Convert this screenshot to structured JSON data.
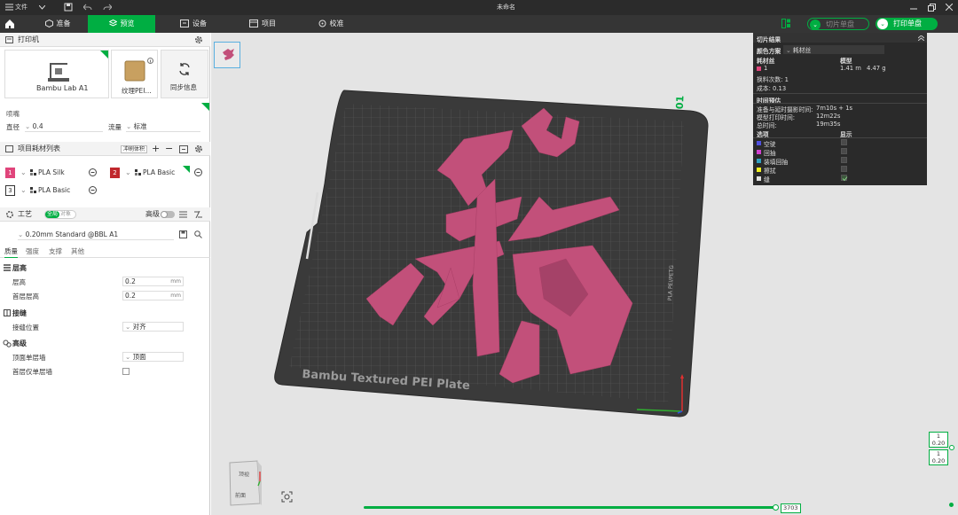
{
  "titlebar": {
    "file_menu": "文件",
    "title": "未命名"
  },
  "tabs": [
    {
      "label": "准备"
    },
    {
      "label": "预览"
    },
    {
      "label": "设备"
    },
    {
      "label": "项目"
    },
    {
      "label": "校准"
    }
  ],
  "toolbar": {
    "slice_label": "切片单盘",
    "print_label": "打印单盘"
  },
  "printer": {
    "section_title": "打印机",
    "printer_name": "Bambu Lab A1",
    "plate_name": "纹理PEI...",
    "sync_label": "同步信息",
    "nozzle_label": "喷嘴",
    "diameter_label": "直径",
    "diameter_value": "0.4",
    "flow_label": "流量",
    "flow_value": "标准"
  },
  "filaments": {
    "section_title": "项目耗材列表",
    "flush_label": "冲刷体积",
    "items": [
      {
        "num": "1",
        "name": "PLA Silk",
        "color": "#e0457b"
      },
      {
        "num": "2",
        "name": "PLA Basic",
        "color": "#c0282d"
      },
      {
        "num": "3",
        "name": "PLA Basic",
        "color": "#ffffff"
      }
    ]
  },
  "process": {
    "section_title": "工艺",
    "global_label": "全局",
    "object_label": "对象",
    "advanced_label": "高级",
    "preset": "0.20mm Standard @BBL A1",
    "subtabs": [
      "质量",
      "强度",
      "支撑",
      "其他"
    ],
    "groups": {
      "layer_height": "层高",
      "seam": "接缝",
      "advanced": "高级"
    },
    "rows": {
      "layer_height_label": "层高",
      "layer_height_value": "0.2",
      "first_layer_label": "首层层高",
      "first_layer_value": "0.2",
      "unit": "mm",
      "seam_pos_label": "接缝位置",
      "seam_pos_value": "对齐",
      "top_surface_label": "顶面单层墙",
      "top_surface_value": "顶面",
      "first_layer_wall_label": "首层仅单层墙"
    }
  },
  "stats": {
    "title": "切片结果",
    "scheme_label": "颜色方案",
    "scheme_value": "耗材丝",
    "col_filament": "耗材丝",
    "col_model": "模型",
    "row1_num": "1",
    "row1_length": "1.41 m",
    "row1_weight": "4.47 g",
    "changes": "换料次数: 1",
    "cost": "成本: 0.13",
    "time_title": "时间预估",
    "prep_label": "准备与延时摄影时间:",
    "prep_value": "7m10s + 1s",
    "model_time_label": "模型打印时间:",
    "model_time_value": "12m22s",
    "total_label": "总时间:",
    "total_value": "19m35s",
    "options_label": "选项",
    "show_label": "显示",
    "legend": [
      {
        "label": "空驶",
        "color": "#5050e0"
      },
      {
        "label": "回抽",
        "color": "#d040d0"
      },
      {
        "label": "装填回抽",
        "color": "#30a0c0"
      },
      {
        "label": "擦拭",
        "color": "#f0f020"
      },
      {
        "label": "缝",
        "color": "#e0e0e0"
      }
    ]
  },
  "plate": {
    "text": "Bambu Textured PEI Plate",
    "number": "01",
    "side_text": "PLA PEI/PETG"
  },
  "vertical_slider": {
    "top_value": "1",
    "top_height": "0.20",
    "bottom_value": "1",
    "bottom_height": "0.20"
  },
  "horizontal_slider": {
    "value": "3703"
  },
  "view_cube": {
    "top": "顶视",
    "front": "前面"
  },
  "colors": {
    "accent": "#00ae42",
    "model": "#c2507a",
    "plate": "#3a3a3a"
  }
}
